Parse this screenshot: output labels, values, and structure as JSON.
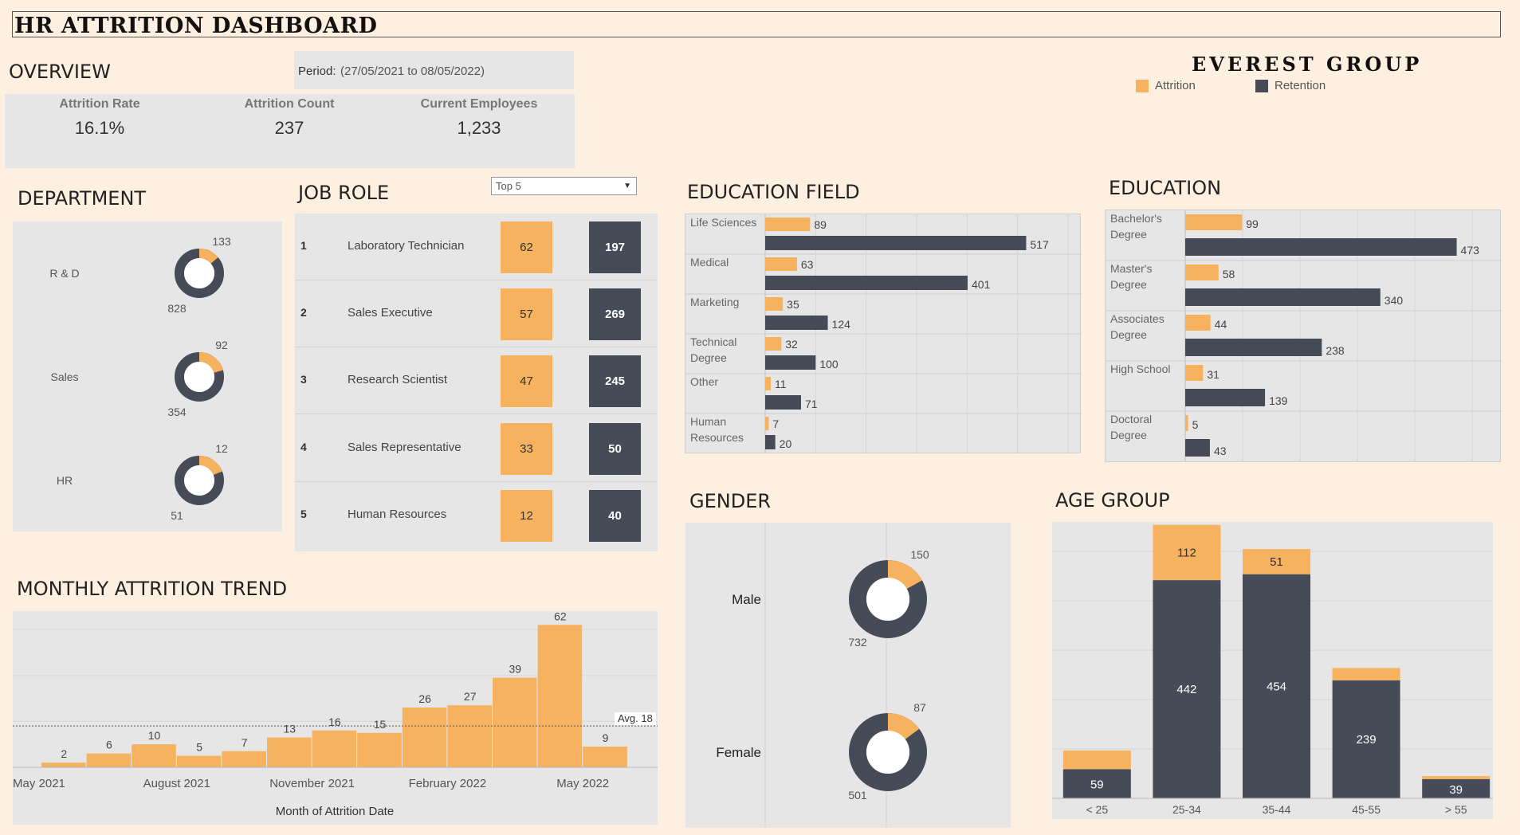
{
  "title": "HR ATTRITION DASHBOARD",
  "brand": "EVEREST GROUP",
  "colors": {
    "attrition": "#f6b25f",
    "retention": "#454b57",
    "background": "#fdf0e1",
    "panel": "#e6e6e6"
  },
  "legend": {
    "attrition": "Attrition",
    "retention": "Retention"
  },
  "overview": {
    "title": "OVERVIEW",
    "period_label": "Period:",
    "period_value": "(27/05/2021  to  08/05/2022)",
    "kpis": [
      {
        "label": "Attrition Rate",
        "value": "16.1%"
      },
      {
        "label": "Attrition Count",
        "value": "237"
      },
      {
        "label": "Current Employees",
        "value": "1,233"
      }
    ]
  },
  "department": {
    "title": "DEPARTMENT"
  },
  "job_role": {
    "title": "JOB ROLE",
    "filter_value": "Top 5",
    "rows": [
      {
        "rank": "1",
        "name": "Laboratory Technician",
        "attrition": "62",
        "retention": "197"
      },
      {
        "rank": "2",
        "name": "Sales Executive",
        "attrition": "57",
        "retention": "269"
      },
      {
        "rank": "3",
        "name": "Research Scientist",
        "attrition": "47",
        "retention": "245"
      },
      {
        "rank": "4",
        "name": "Sales Representative",
        "attrition": "33",
        "retention": "50"
      },
      {
        "rank": "5",
        "name": "Human Resources",
        "attrition": "12",
        "retention": "40"
      }
    ]
  },
  "education_field": {
    "title": "EDUCATION FIELD"
  },
  "education": {
    "title": "EDUCATION"
  },
  "gender": {
    "title": "GENDER"
  },
  "age_group": {
    "title": "AGE GROUP"
  },
  "monthly_trend": {
    "title": "MONTHLY ATTRITION TREND"
  },
  "chart_data": [
    {
      "id": "department",
      "type": "pie",
      "donut": true,
      "categories": [
        "R & D",
        "Sales",
        "HR"
      ],
      "series": [
        {
          "name": "Attrition",
          "values": [
            133,
            92,
            12
          ]
        },
        {
          "name": "Retention",
          "values": [
            828,
            354,
            51
          ]
        }
      ]
    },
    {
      "id": "education_field",
      "type": "bar",
      "orientation": "horizontal",
      "categories": [
        "Life Sciences",
        "Medical",
        "Marketing",
        "Technical Degree",
        "Other",
        "Human Resources"
      ],
      "series": [
        {
          "name": "Attrition",
          "values": [
            89,
            63,
            35,
            32,
            11,
            7
          ]
        },
        {
          "name": "Retention",
          "values": [
            517,
            401,
            124,
            100,
            71,
            20
          ]
        }
      ],
      "xlim": [
        0,
        600
      ]
    },
    {
      "id": "education",
      "type": "bar",
      "orientation": "horizontal",
      "categories": [
        "Bachelor's Degree",
        "Master's Degree",
        "Associates Degree",
        "High School",
        "Doctoral Degree"
      ],
      "series": [
        {
          "name": "Attrition",
          "values": [
            99,
            58,
            44,
            31,
            5
          ]
        },
        {
          "name": "Retention",
          "values": [
            473,
            340,
            238,
            139,
            43
          ]
        }
      ],
      "xlim": [
        0,
        550
      ]
    },
    {
      "id": "gender",
      "type": "pie",
      "donut": true,
      "categories": [
        "Male",
        "Female"
      ],
      "series": [
        {
          "name": "Attrition",
          "values": [
            150,
            87
          ]
        },
        {
          "name": "Retention",
          "values": [
            732,
            501
          ]
        }
      ]
    },
    {
      "id": "age_group",
      "type": "bar",
      "stacked": true,
      "categories": [
        "< 25",
        "25-34",
        "35-44",
        "45-55",
        "> 55"
      ],
      "series": [
        {
          "name": "Retention",
          "values": [
            59,
            442,
            454,
            239,
            39
          ]
        },
        {
          "name": "Attrition",
          "values": [
            38,
            112,
            51,
            25,
            6
          ]
        }
      ],
      "attrition_labels": [
        "",
        "112",
        "51",
        "",
        ""
      ],
      "ylim": [
        0,
        560
      ]
    },
    {
      "id": "monthly_trend",
      "type": "bar",
      "x": [
        "May 2021",
        "Jun 2021",
        "Jul 2021",
        "Aug 2021",
        "Sep 2021",
        "Oct 2021",
        "Nov 2021",
        "Dec 2021",
        "Jan 2022",
        "Feb 2022",
        "Mar 2022",
        "Apr 2022",
        "May 2022"
      ],
      "values": [
        2,
        6,
        10,
        5,
        7,
        13,
        16,
        15,
        26,
        27,
        39,
        62,
        9
      ],
      "tick_labels": [
        "May 2021",
        "August 2021",
        "November 2021",
        "February 2022",
        "May 2022"
      ],
      "xlabel": "Month of Attrition Date",
      "reference_line": {
        "label": "Avg. 18",
        "value": 18
      },
      "ylim": [
        0,
        68
      ]
    }
  ]
}
